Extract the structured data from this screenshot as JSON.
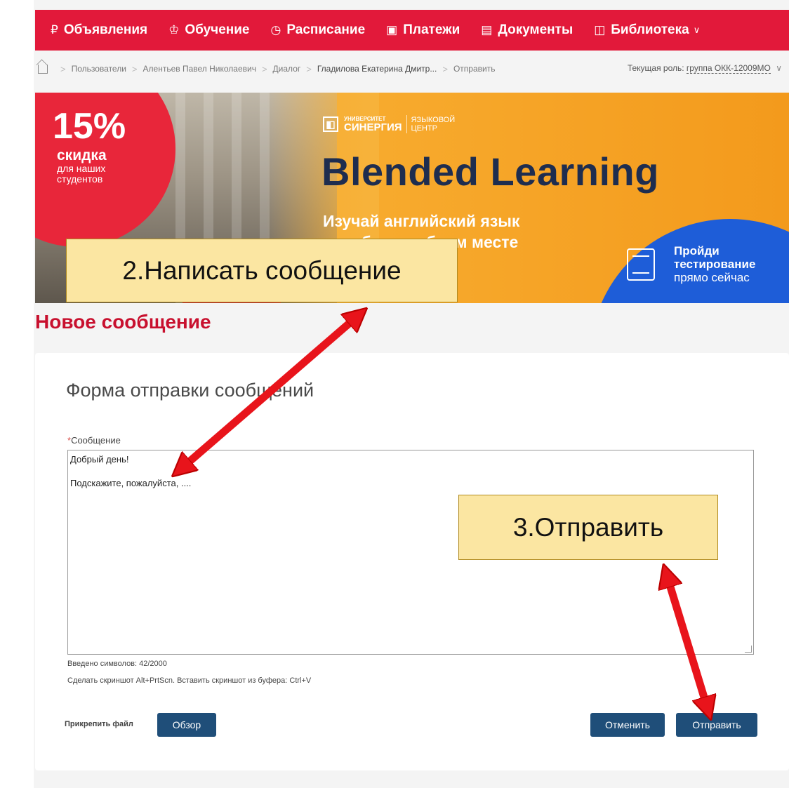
{
  "nav": {
    "items": [
      {
        "icon": "announcement-icon",
        "glyph": "₽",
        "label": "Объявления"
      },
      {
        "icon": "graduation-icon",
        "glyph": "♔",
        "label": "Обучение"
      },
      {
        "icon": "clock-icon",
        "glyph": "◷",
        "label": "Расписание"
      },
      {
        "icon": "payment-icon",
        "glyph": "▣",
        "label": "Платежи"
      },
      {
        "icon": "document-icon",
        "glyph": "▤",
        "label": "Документы"
      },
      {
        "icon": "library-icon",
        "glyph": "◫",
        "label": "Библиотека"
      }
    ]
  },
  "breadcrumb": {
    "items": [
      "Пользователи",
      "Алентьев Павел Николаевич",
      "Диалог",
      "Гладилова Екатерина Дмитр...",
      "Отправить"
    ],
    "role_label": "Текущая роль:",
    "role_value": "группа ОКК-12009МО"
  },
  "banner": {
    "discount_pct": "15%",
    "discount_word": "скидка",
    "discount_sub": "для наших студентов",
    "logo_university": "УНИВЕРСИТЕТ",
    "logo_name": "СИНЕРГИЯ",
    "logo_center_1": "ЯЗЫКОВОЙ",
    "logo_center_2": "ЦЕНТР",
    "title": "Blended Learning",
    "sub1": "Изучай английский язык",
    "sub2": "в любом удобном месте",
    "test_1": "Пройди",
    "test_2": "тестирование",
    "test_3": "прямо сейчас"
  },
  "annotations": {
    "step2": "2.Написать сообщение",
    "step3": "3.Отправить",
    "arrow_color": "#e8141b"
  },
  "page": {
    "title": "Новое сообщение"
  },
  "form": {
    "title": "Форма отправки сообщений",
    "required_mark": "*",
    "message_label": "Сообщение",
    "message_line1": "Добрый день!",
    "message_line2": "Подскажите, пожалуйста, ....",
    "counter": "Введено символов: 42/2000",
    "hint": "Сделать скриншот Alt+PrtScn. Вставить скриншот из буфера: Ctrl+V",
    "attach_label": "Прикрепить файл",
    "browse_button": "Обзор",
    "cancel_button": "Отменить",
    "send_button": "Отправить"
  }
}
